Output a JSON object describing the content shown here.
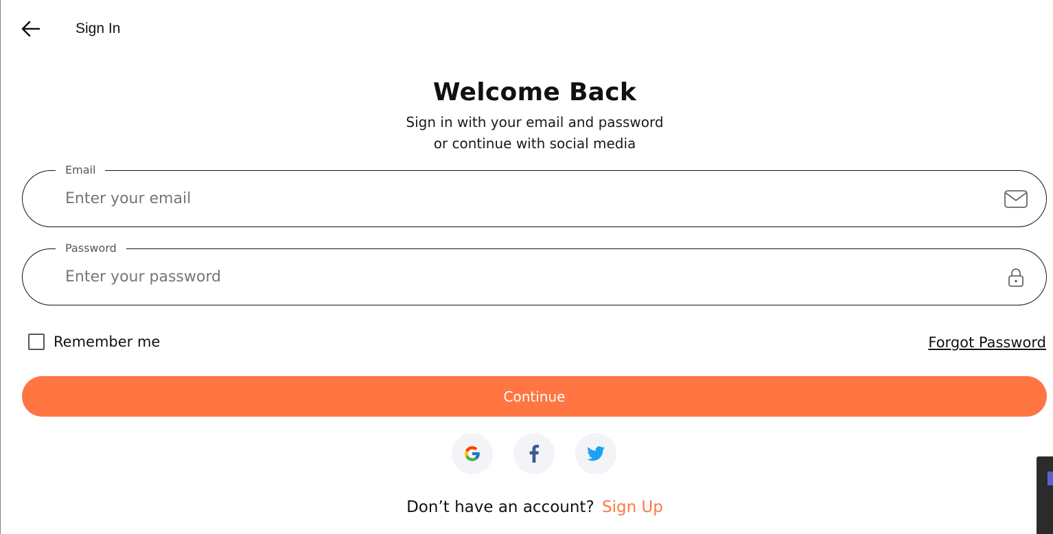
{
  "appbar": {
    "back_icon": "arrow-left-icon",
    "title": "Sign In"
  },
  "header": {
    "title": "Welcome Back",
    "subtitle_line1": "Sign in with your email and password",
    "subtitle_line2": "or continue with social media"
  },
  "form": {
    "email": {
      "label": "Email",
      "placeholder": "Enter your email",
      "value": "",
      "icon": "mail-icon"
    },
    "password": {
      "label": "Password",
      "placeholder": "Enter your password",
      "value": "",
      "icon": "lock-icon"
    },
    "remember_label": "Remember me",
    "remember_checked": false,
    "forgot_label": "Forgot Password",
    "continue_label": "Continue"
  },
  "social": [
    {
      "name": "google",
      "icon": "google-icon"
    },
    {
      "name": "facebook",
      "icon": "facebook-icon"
    },
    {
      "name": "twitter",
      "icon": "twitter-icon"
    }
  ],
  "footer": {
    "prompt": "Don’t have an account?",
    "signup_label": "Sign Up"
  },
  "colors": {
    "accent": "#ff7643",
    "text": "#111111",
    "social_bg": "#f3f4f8"
  }
}
